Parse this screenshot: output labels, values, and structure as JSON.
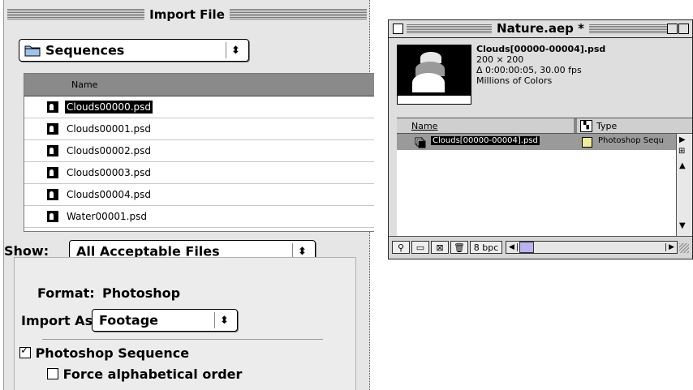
{
  "import_dialog": {
    "title": "Import File",
    "folder_popup": "Sequences",
    "list_header": "Name",
    "files": [
      {
        "name": "Clouds00000.psd",
        "selected": true
      },
      {
        "name": "Clouds00001.psd",
        "selected": false
      },
      {
        "name": "Clouds00002.psd",
        "selected": false
      },
      {
        "name": "Clouds00003.psd",
        "selected": false
      },
      {
        "name": "Clouds00004.psd",
        "selected": false
      },
      {
        "name": "Water00001.psd",
        "selected": false
      }
    ],
    "show_label": "Show:",
    "show_value": "All Acceptable Files",
    "format_label": "Format:",
    "format_value": "Photoshop",
    "import_as_label": "Import As:",
    "import_as_value": "Footage",
    "photoshop_sequence": {
      "label": "Photoshop Sequence",
      "checked": true
    },
    "force_alpha": {
      "label": "Force alphabetical order",
      "checked": false
    }
  },
  "project_window": {
    "title": "Nature.aep *",
    "info": {
      "name": "Clouds[00000-00004].psd",
      "size": "200 × 200",
      "duration": "Δ 0:00:00:05, 30.00 fps",
      "colors": "Millions of Colors"
    },
    "columns": {
      "name": "Name",
      "type": "Type"
    },
    "item": {
      "name": "Clouds[00000-00004].psd",
      "type": "Photoshop Sequ"
    },
    "bit_depth": "8 bpc"
  }
}
